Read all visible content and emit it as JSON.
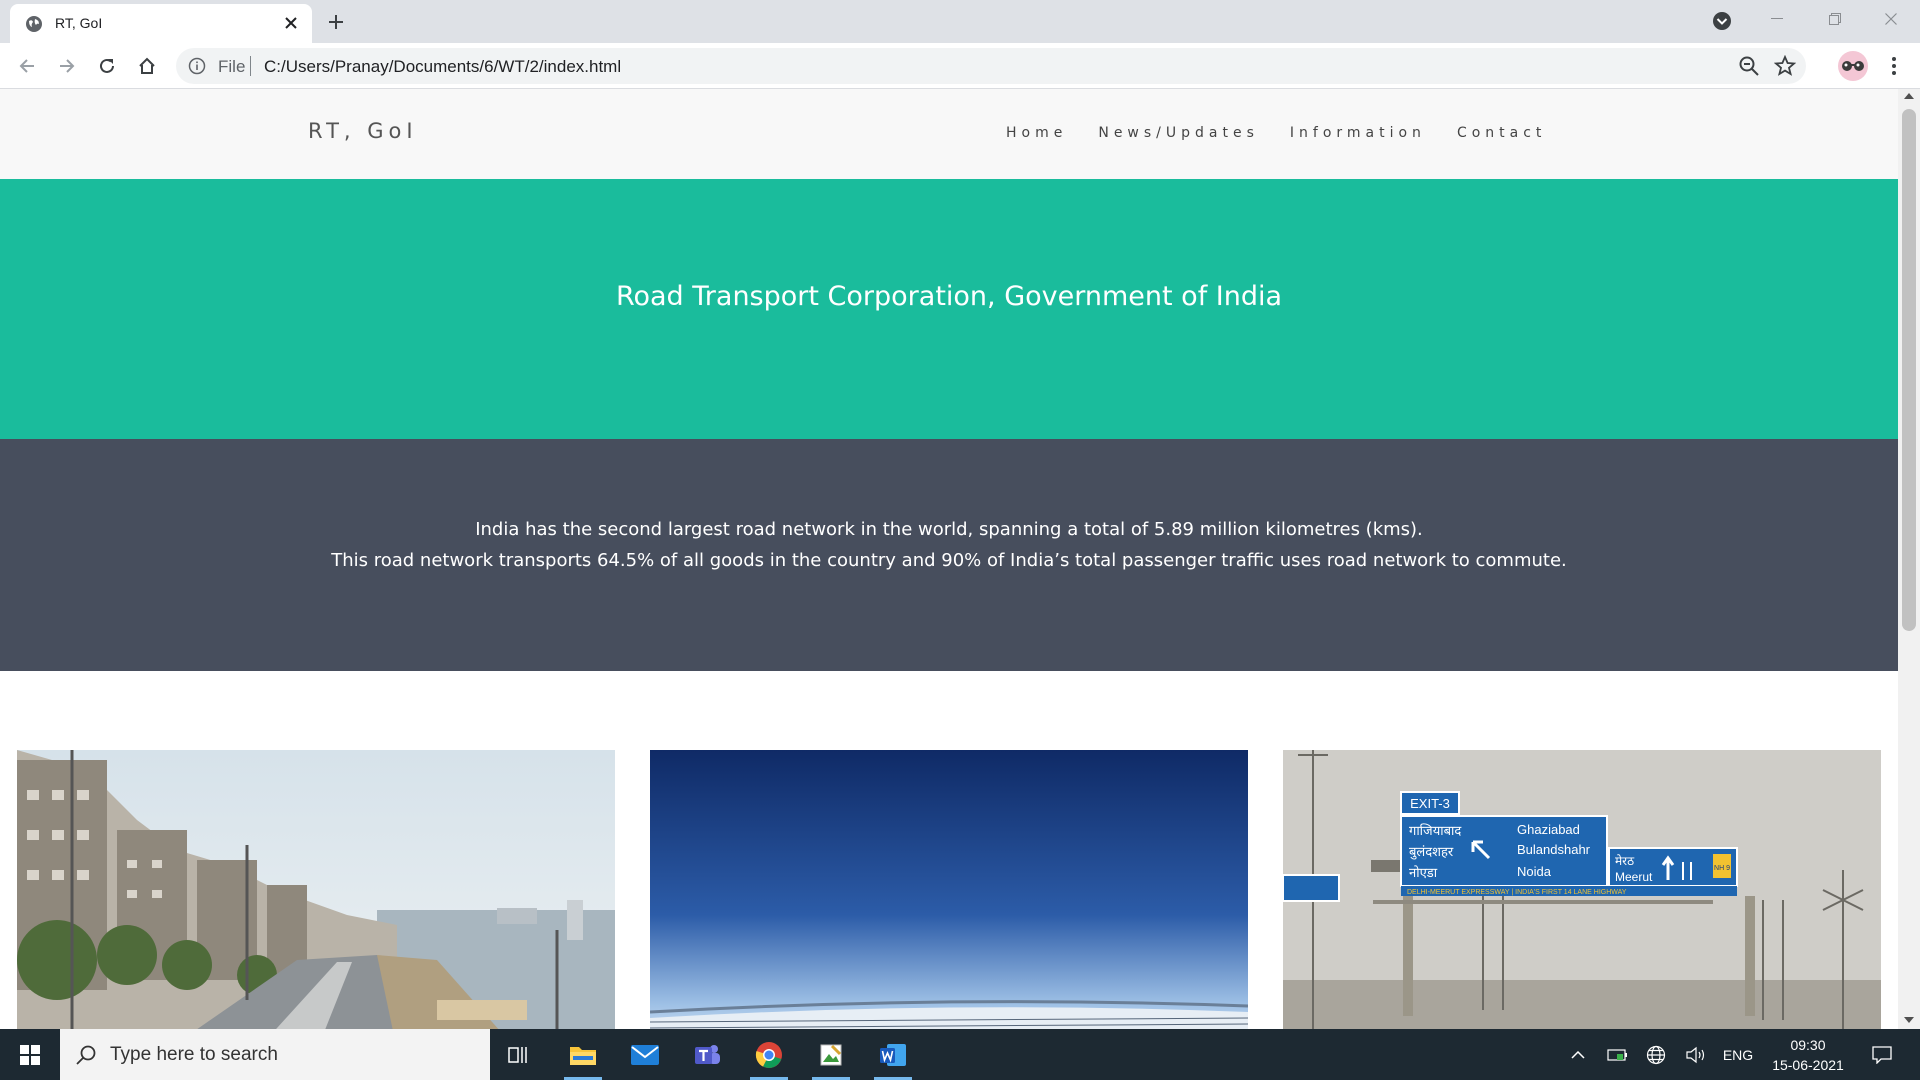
{
  "browser": {
    "tab_title": "RT, GoI",
    "address_scheme_label": "File",
    "address_url": "C:/Users/Pranay/Documents/6/WT/2/index.html"
  },
  "site": {
    "logo": "RT, GoI",
    "nav": [
      "Home",
      "News/Updates",
      "Information",
      "Contact"
    ],
    "hero_title": "Road Transport Corporation, Government of India",
    "intro_lines": [
      "India has the second largest road network in the world, spanning a total of 5.89 million kilometres (kms).",
      "This road network transports 64.5% of all goods in the country and 90% of India’s total passenger traffic uses road network to commute."
    ],
    "sign": {
      "exit": "EXIT-3",
      "hindi_left": [
        "गाजियाबाद",
        "बुलंदशहर",
        "नोएडा"
      ],
      "english_left": [
        "Ghaziabad",
        "Bulandshahr",
        "Noida"
      ],
      "right_hindi": "मेरठ",
      "right_english": "Meerut",
      "nh": "NH 9",
      "banner": "DELHI-MEERUT EXPRESSWAY | INDIA'S FIRST 14 LANE HIGHWAY"
    }
  },
  "taskbar": {
    "search_placeholder": "Type here to search",
    "language": "ENG",
    "time": "09:30",
    "date": "15-06-2021"
  },
  "colors": {
    "hero": "#1abc9c",
    "info_band": "#474e5d",
    "header": "#f8f8f8",
    "taskbar": "#1d2932"
  }
}
